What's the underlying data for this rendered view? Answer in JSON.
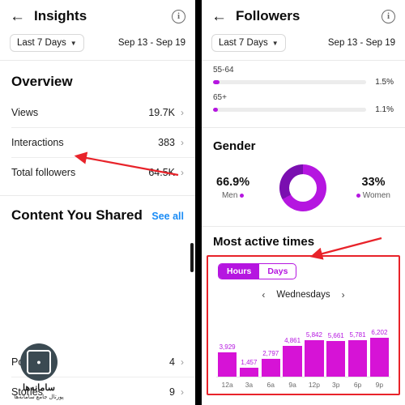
{
  "left": {
    "header": {
      "back_icon": "back-arrow-icon",
      "title": "Insights",
      "info_icon": "info-icon"
    },
    "date": {
      "chip_label": "Last 7 Days",
      "range": "Sep 13 - Sep 19"
    },
    "overview": {
      "title": "Overview",
      "rows": [
        {
          "label": "Views",
          "value": "19.7K"
        },
        {
          "label": "Interactions",
          "value": "383"
        },
        {
          "label": "Total followers",
          "value": "64.5K"
        }
      ]
    },
    "content_shared": {
      "title": "Content You Shared",
      "see_all": "See all",
      "rows": [
        {
          "label": "Posts",
          "value": "4"
        },
        {
          "label": "Stories",
          "value": "9"
        }
      ]
    }
  },
  "right": {
    "header": {
      "back_icon": "back-arrow-icon",
      "title": "Followers",
      "info_icon": "info-icon"
    },
    "date": {
      "chip_label": "Last 7 Days",
      "range": "Sep 13 - Sep 19"
    },
    "age_ranges": [
      {
        "label": "55-64",
        "pct": "1.5%",
        "fill": 4
      },
      {
        "label": "65+",
        "pct": "1.1%",
        "fill": 3
      }
    ],
    "gender": {
      "title": "Gender",
      "men_pct": "66.9%",
      "men_label": "Men",
      "women_pct": "33%",
      "women_label": "Women"
    },
    "most_active": {
      "title": "Most active times",
      "tabs": [
        {
          "label": "Hours",
          "active": true
        },
        {
          "label": "Days",
          "active": false
        }
      ],
      "day": "Wednesdays",
      "prev_icon": "chevron-left-icon",
      "next_icon": "chevron-right-icon"
    }
  },
  "chart_data": {
    "type": "bar",
    "title": "Most active times",
    "subtitle": "Wednesdays",
    "categories": [
      "12a",
      "3a",
      "6a",
      "9a",
      "12p",
      "3p",
      "6p",
      "9p"
    ],
    "values": [
      3929,
      1457,
      2797,
      4861,
      5842,
      5661,
      5781,
      6202
    ],
    "labels": [
      "3,929",
      "1,457",
      "2,797",
      "4,861",
      "5,842",
      "5,661",
      "5,781",
      "6,202"
    ],
    "xlabel": "",
    "ylabel": "",
    "ylim": [
      0,
      6202
    ],
    "grid": false,
    "legend": "none",
    "bar_color": "#d613d6",
    "label_color": "#b516e0"
  },
  "colors": {
    "accent": "#b516e0",
    "bar": "#d613d6",
    "link": "#1b8cf5",
    "annotation": "#e8232a",
    "divider": "#000000"
  },
  "watermark": {
    "fa_title": "سامانه‌ها",
    "fa_sub": "پورتال جامع سامانه‌ها",
    "badge_icon": "logo-icon"
  }
}
